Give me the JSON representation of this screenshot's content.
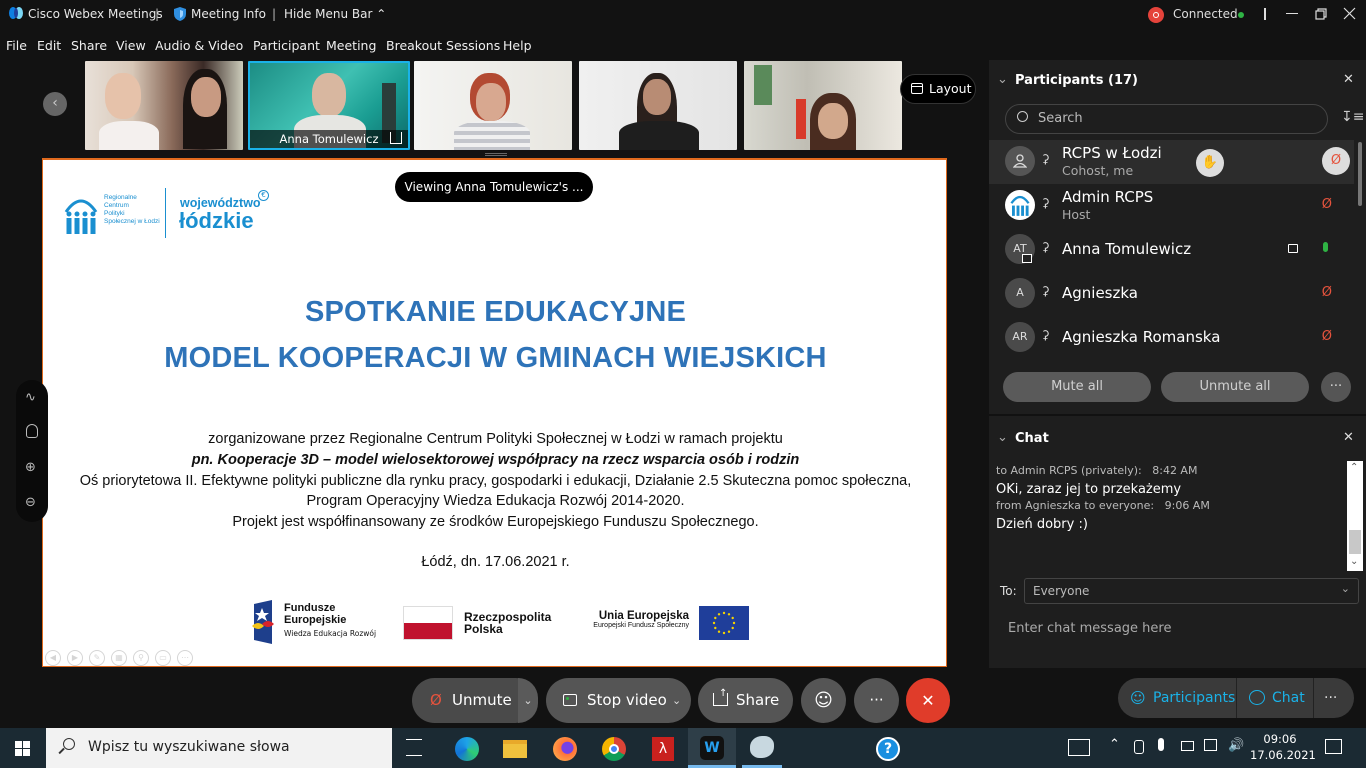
{
  "titlebar": {
    "app_name": "Cisco Webex Meetings",
    "meeting_info": "Meeting Info",
    "hide_menu": "Hide Menu Bar",
    "status": "Connected",
    "separator": "|"
  },
  "menu": {
    "items": [
      "File",
      "Edit",
      "Share",
      "View",
      "Audio & Video",
      "Participant",
      "Meeting",
      "Breakout Sessions",
      "Help"
    ]
  },
  "video_strip": {
    "active_name": "Anna Tomulewicz",
    "layout_label": "Layout"
  },
  "viewing_badge": "Viewing Anna Tomulewicz's ...",
  "slide": {
    "logo_rcps_lines": [
      "Regionalne",
      "Centrum",
      "Polityki",
      "Społecznej w Łodzi"
    ],
    "logo_region_top": "województwo",
    "logo_region_bottom": "łódzkie",
    "title_line1": "SPOTKANIE EDUKACYJNE",
    "title_line2": "MODEL KOOPERACJI W GMINACH WIEJSKICH",
    "body_line1": "zorganizowane przez Regionalne Centrum Polityki Społecznej w Łodzi w ramach projektu",
    "body_line2": "pn. Kooperacje 3D – model wielosektorowej współpracy na rzecz wsparcia osób i rodzin",
    "body_line3": "Oś priorytetowa II. Efektywne polityki publiczne dla rynku pracy, gospodarki i edukacji, Działanie 2.5 Skuteczna pomoc społeczna,",
    "body_line4": "Program Operacyjny Wiedza Edukacja Rozwój 2014-2020.",
    "body_line5": "Projekt jest współfinansowany ze środków Europejskiego Funduszu Społecznego.",
    "date_line": "Łódź, dn. 17.06.2021 r.",
    "fe_line1": "Fundusze",
    "fe_line2": "Europejskie",
    "fe_line3": "Wiedza Edukacja Rozwój",
    "rp_line1": "Rzeczpospolita",
    "rp_line2": "Polska",
    "ue_line1": "Unia Europejska",
    "ue_line2": "Europejski Fundusz Społeczny"
  },
  "participants": {
    "header": "Participants (17)",
    "search_placeholder": "Search",
    "list": [
      {
        "initials": "",
        "name": "RCPS w Łodzi",
        "role": "Cohost, me",
        "mic": "muted"
      },
      {
        "initials": "",
        "name": "Admin RCPS",
        "role": "Host",
        "mic": "muted"
      },
      {
        "initials": "AT",
        "name": "Anna Tomulewicz",
        "role": "",
        "mic": "active"
      },
      {
        "initials": "A",
        "name": "Agnieszka",
        "role": "",
        "mic": "muted"
      },
      {
        "initials": "AR",
        "name": "Agnieszka Romanska",
        "role": "",
        "mic": "muted"
      }
    ],
    "mute_all": "Mute all",
    "unmute_all": "Unmute all",
    "more": "···"
  },
  "chat": {
    "header": "Chat",
    "messages": [
      {
        "meta": "to Admin RCPS (privately):",
        "time": "8:42 AM",
        "text": "OKi, zaraz jej to przekażemy"
      },
      {
        "meta": "from Agnieszka to everyone:",
        "time": "9:06 AM",
        "text": "Dzień dobry :)"
      }
    ],
    "to_label": "To:",
    "to_value": "Everyone",
    "input_placeholder": "Enter chat message here"
  },
  "controls": {
    "unmute": "Unmute",
    "stop_video": "Stop video",
    "share": "Share",
    "participants": "Participants",
    "chat": "Chat",
    "more": "···"
  },
  "colors": {
    "accent_blue": "#1ab2e8",
    "end_red": "#e03c2a",
    "slide_title_blue": "#2e73b8",
    "connected_green": "#2fb344",
    "muted_red": "#e5533d"
  },
  "taskbar": {
    "search_placeholder": "Wpisz tu wyszukiwane słowa",
    "time": "09:06",
    "date": "17.06.2021"
  }
}
